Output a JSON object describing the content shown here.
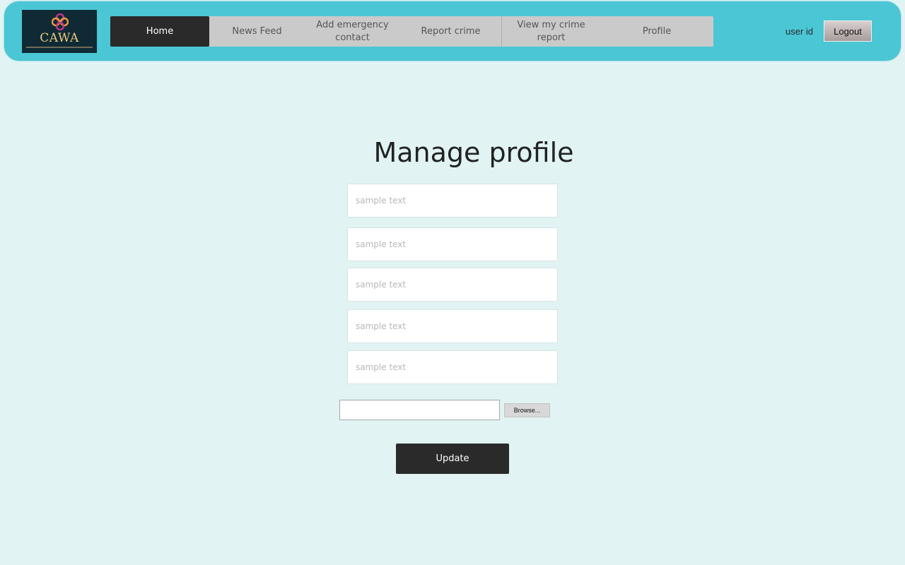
{
  "header": {
    "logo": {
      "text": "CAWA",
      "icon": "clover-logo-icon",
      "colors": {
        "background": "#0f2a35",
        "text": "#f0c880",
        "mark_primary": "#c03a8a",
        "mark_secondary": "#f09a40"
      }
    },
    "nav": {
      "items": [
        {
          "label": "Home",
          "active": true
        },
        {
          "label": "News Feed",
          "active": false
        },
        {
          "label": "Add emergency contact",
          "active": false
        },
        {
          "label": "Report crime",
          "active": false
        },
        {
          "label": "View my crime report",
          "active": false
        },
        {
          "label": "Profile",
          "active": false
        }
      ]
    },
    "user_id_label": "user id",
    "logout_label": "Logout"
  },
  "main": {
    "title": "Manage profile",
    "fields": [
      {
        "placeholder": "sample text",
        "value": ""
      },
      {
        "placeholder": "sample text",
        "value": ""
      },
      {
        "placeholder": "sample text",
        "value": ""
      },
      {
        "placeholder": "sample text",
        "value": ""
      },
      {
        "placeholder": "sample text",
        "value": ""
      }
    ],
    "file_upload": {
      "value": "",
      "browse_label": "Browse..."
    },
    "update_label": "Update"
  },
  "colors": {
    "page_background": "#e1f3f3",
    "header_background": "#4bc6d4",
    "nav_background": "#cacaca",
    "nav_active": "#2a2a2a",
    "button_dark": "#2a2a2a"
  }
}
